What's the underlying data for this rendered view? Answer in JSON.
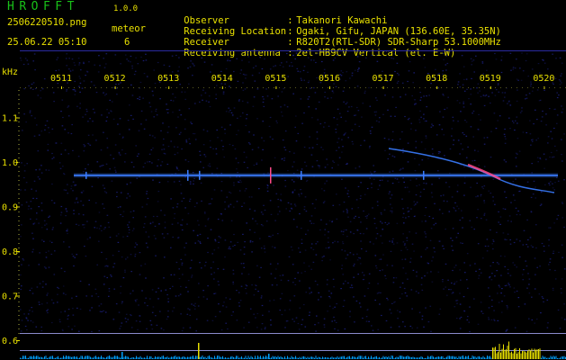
{
  "header": {
    "app_name": "HROFFT",
    "app_version": "1.0.0",
    "file_name": "2506220510.png",
    "meteor_label": "meteor",
    "date_time": "25.06.22 05:10",
    "meteor_count": "6"
  },
  "info": [
    {
      "key": "Observer",
      "sep": ":",
      "value": "Takanori Kawachi"
    },
    {
      "key": "Receiving Location",
      "sep": ":",
      "value": "Ogaki, Gifu, JAPAN (136.60E, 35.35N)"
    },
    {
      "key": "Receiver",
      "sep": ":",
      "value": "R820T2(RTL-SDR) SDR-Sharp 53.1000MHz"
    },
    {
      "key": "Receiving antenna",
      "sep": ":",
      "value": "2el-HB9CV Vertical (el. E-W)"
    }
  ],
  "chart_data": {
    "type": "heatmap",
    "y_unit": "kHz",
    "x_ticks": [
      "0511",
      "0512",
      "0513",
      "0514",
      "0515",
      "0516",
      "0517",
      "0518",
      "0519",
      "0520"
    ],
    "y_ticks": [
      "1.1",
      "1.0",
      "0.9",
      "0.8",
      "0.7",
      "0.6"
    ],
    "ylim": [
      0.6,
      1.15
    ],
    "carrier_khz": 0.97,
    "colors": {
      "background": "#000000",
      "noise": "#1a1f78",
      "carrier": "#3a7cff",
      "echo_core": "#ff4a8a",
      "spectrum_low": "#00a0ff",
      "spectrum_high": "#e8e000",
      "axis_text": "#e8e000",
      "title": "#19c119"
    }
  }
}
